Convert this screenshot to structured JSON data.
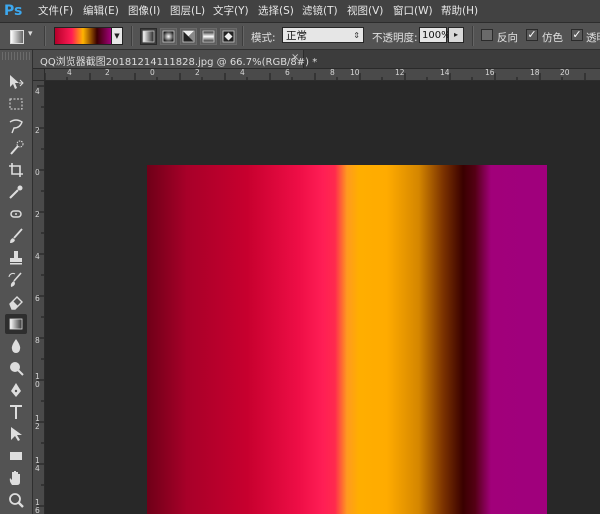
{
  "app": {
    "logo": "Ps"
  },
  "menu": [
    "文件(F)",
    "编辑(E)",
    "图像(I)",
    "图层(L)",
    "文字(Y)",
    "选择(S)",
    "滤镜(T)",
    "视图(V)",
    "窗口(W)",
    "帮助(H)"
  ],
  "options": {
    "mode_label": "模式:",
    "mode_value": "正常",
    "opacity_label": "不透明度:",
    "opacity_value": "100%",
    "reverse_label": "反向",
    "dither_label": "仿色",
    "transparency_label": "透明",
    "reverse_checked": false,
    "dither_checked": true,
    "transparency_checked": true
  },
  "document": {
    "tab_title": "QQ浏览器截图20181214111828.jpg @ 66.7%(RGB/8#) *",
    "close_glyph": "×"
  },
  "rulers": {
    "horizontal": [
      "4",
      "2",
      "0",
      "2",
      "4",
      "6",
      "8",
      "10",
      "12",
      "14",
      "16",
      "18",
      "20"
    ],
    "vertical": [
      "4",
      "2",
      "0",
      "2",
      "4",
      "6",
      "8",
      "1 0",
      "1 2",
      "1 4",
      "1 6"
    ]
  },
  "gradient_colors": [
    "#6f0018",
    "#c7002e",
    "#ff1e55",
    "#ffae00",
    "#3a0000",
    "#a0007d"
  ]
}
